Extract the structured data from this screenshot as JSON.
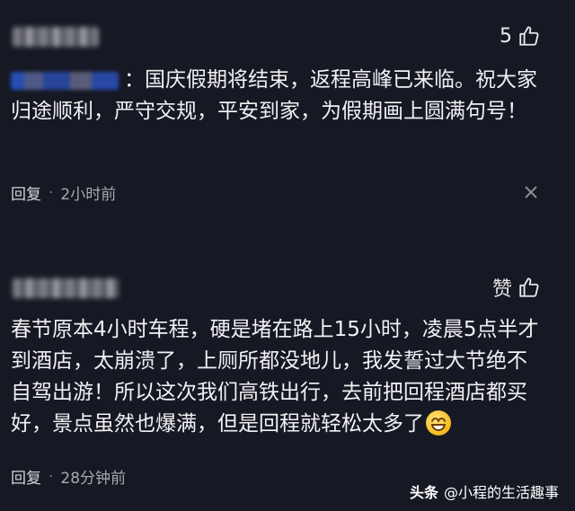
{
  "comments": [
    {
      "likes": "5",
      "text": "：国庆假期将结束，返程高峰已来临。祝大家归途顺利，严守交规，平安到家，为假期画上圆满句号！",
      "reply_label": "回复",
      "time": "2小时前"
    },
    {
      "likes": "赞",
      "text": "春节原本4小时车程，硬是堵在路上15小时，凌晨5点半才到酒店，太崩溃了，上厕所都没地儿，我发誓过大节绝不自驾出游！所以这次我们高铁出行，去前把回程酒店都买好，景点虽然也爆满，但是回程就轻松太多了",
      "reply_label": "回复",
      "time": "28分钟前"
    }
  ],
  "watermark": {
    "brand": "头条",
    "author": "@小程的生活趣事"
  },
  "icons": [
    "thumb-up-icon",
    "close-icon",
    "grin-emoji-icon"
  ]
}
